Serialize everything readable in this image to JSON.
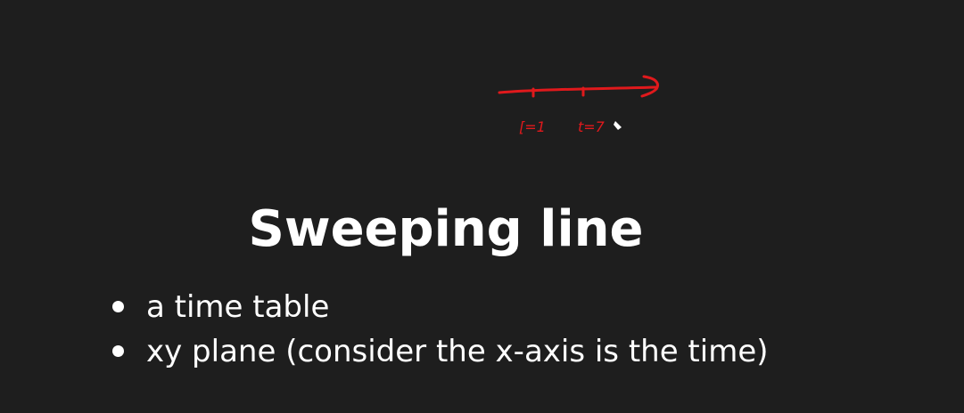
{
  "slide": {
    "title": "Sweeping line",
    "bullets": [
      "a time table",
      "xy plane (consider the x-axis is the time)"
    ]
  },
  "annotation": {
    "color": "#e0191c",
    "labels": [
      "[=1",
      "t=7"
    ]
  }
}
